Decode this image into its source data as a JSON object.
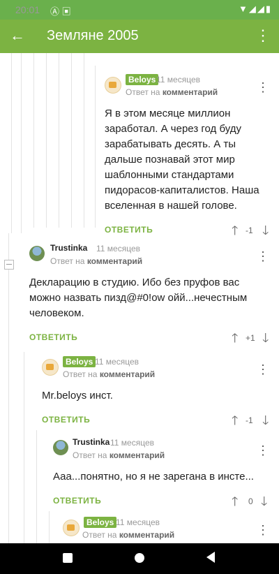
{
  "status": {
    "time": "20:01",
    "left_icons": "Ⓐ ▣",
    "right_icons": "▼◢◢▮"
  },
  "appbar": {
    "title": "Земляне 2005",
    "back_icon": "←",
    "menu_icon": "⋮"
  },
  "comments": [
    {
      "author": "Beloys",
      "time": "11 месяцев",
      "reply_prefix": "Ответ на",
      "reply_target": "комментарий",
      "text": "Я в этом месяце миллион заработал. А через год буду зарабатывать десять. А ты дальше познавай этот мир шаблонными стандартами пидорасов-капиталистов. Наша вселенная в нашей голове.",
      "reply_label": "ОТВЕТИТЬ",
      "score": "-1"
    },
    {
      "author": "Trustinka",
      "time": "11 месяцев",
      "reply_prefix": "Ответ на",
      "reply_target": "комментарий",
      "text": "Декларацию в студию. Ибо без пруфов вас можно назвать пизд@#0!ow ойй...нечестным человеком.",
      "reply_label": "ОТВЕТИТЬ",
      "score": "+1"
    },
    {
      "author": "Beloys",
      "time": "11 месяцев",
      "reply_prefix": "Ответ на",
      "reply_target": "комментарий",
      "text": "Mr.beloys инст.",
      "reply_label": "ОТВЕТИТЬ",
      "score": "-1"
    },
    {
      "author": "Trustinka",
      "time": "11 месяцев",
      "reply_prefix": "Ответ на",
      "reply_target": "комментарий",
      "text": "Ааа...понятно, но я не зарегана в инсте...",
      "reply_label": "ОТВЕТИТЬ",
      "score": "0"
    },
    {
      "author": "Beloys",
      "time": "11 месяцев",
      "reply_prefix": "Ответ на",
      "reply_target": "комментарий"
    }
  ],
  "icons": {
    "kebab": "⋮",
    "up": "🡑",
    "down": "🡓"
  },
  "colors": {
    "accent": "#7cb342",
    "status_bar": "#6ab04c"
  }
}
